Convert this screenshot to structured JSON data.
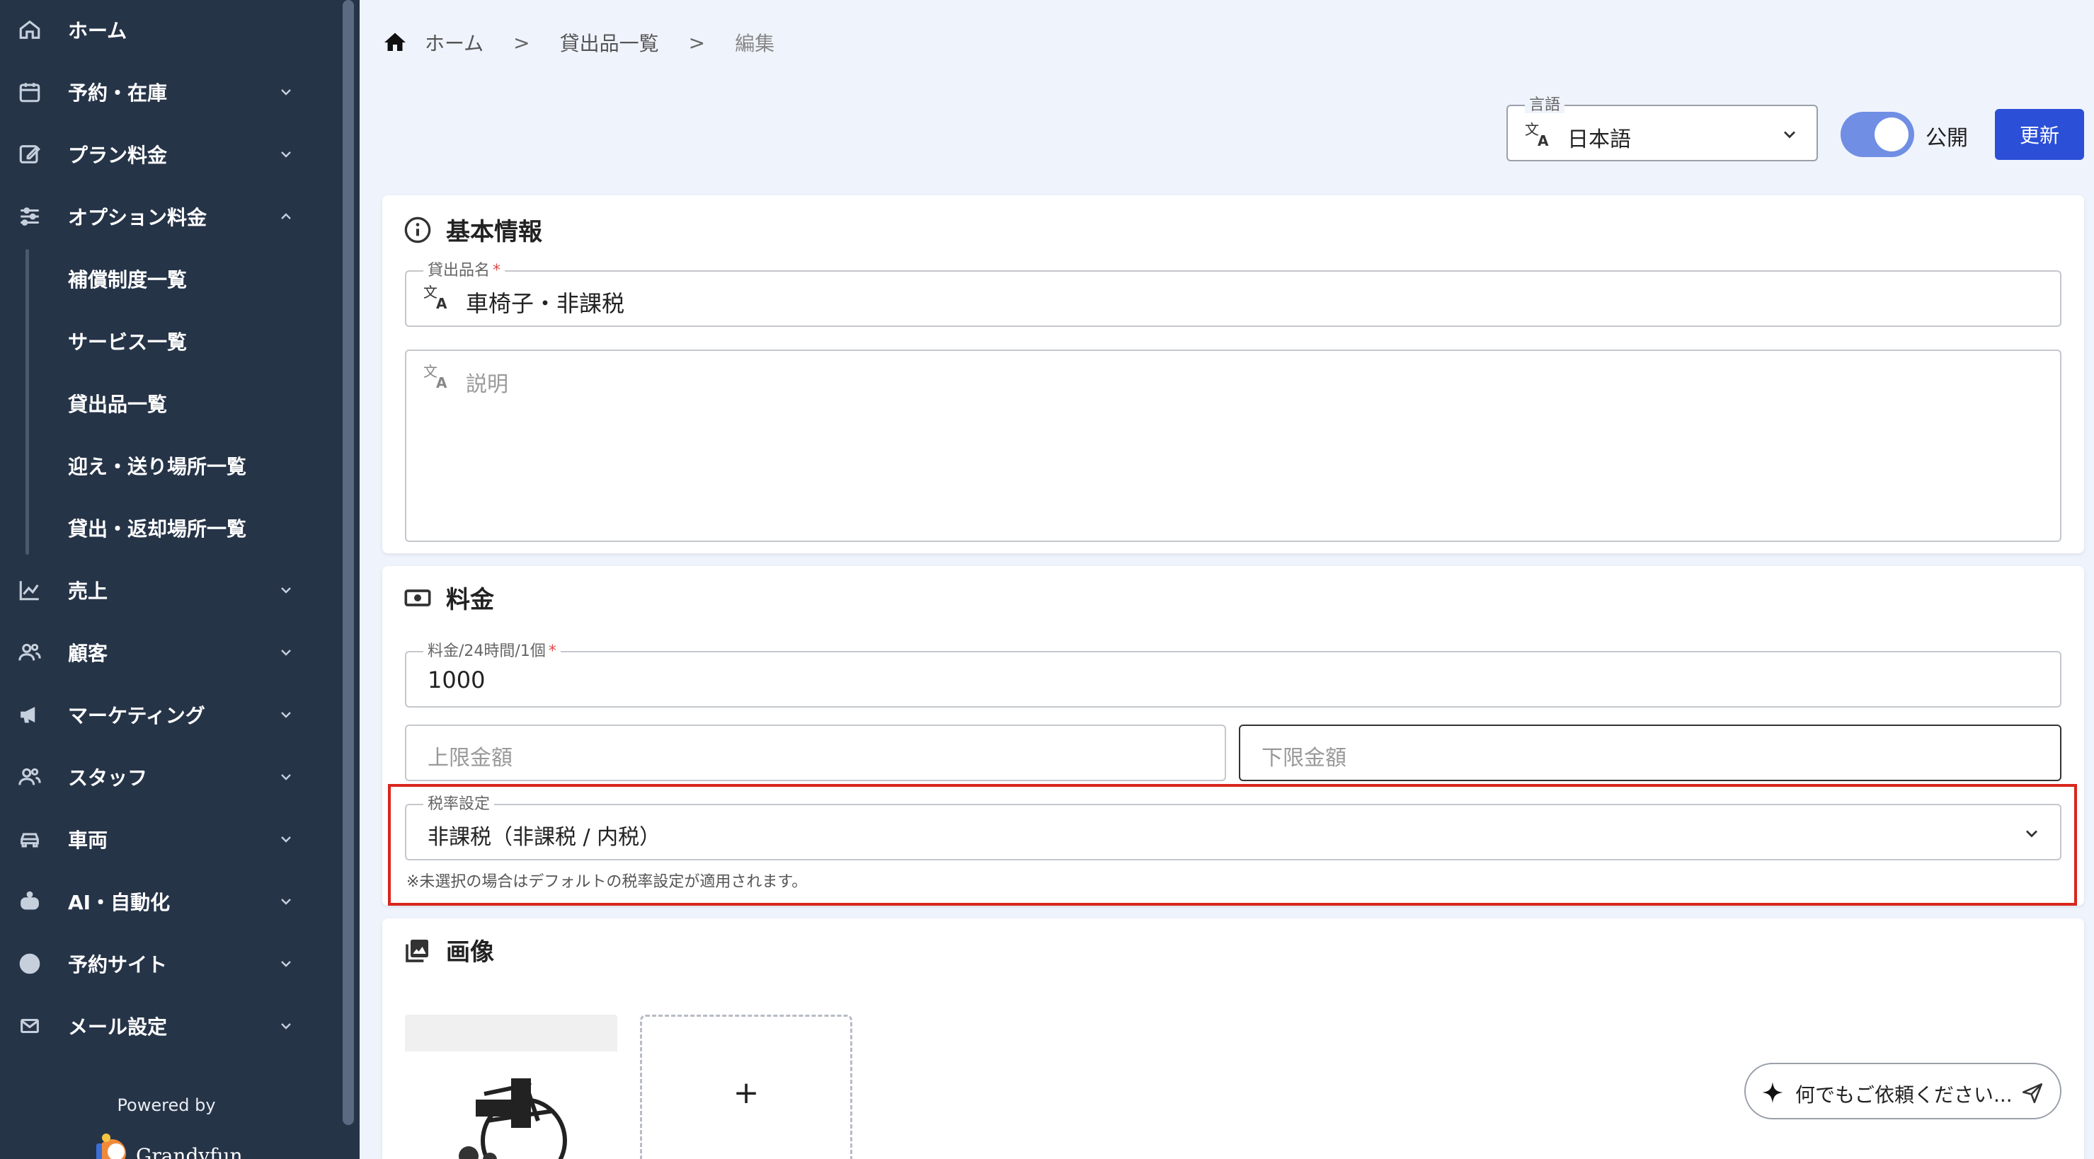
{
  "sidebar": {
    "items": [
      {
        "label": "ホーム",
        "icon": "home-icon",
        "chevron": ""
      },
      {
        "label": "予約・在庫",
        "icon": "calendar-icon",
        "chevron": "down"
      },
      {
        "label": "プラン料金",
        "icon": "edit-icon",
        "chevron": "down"
      },
      {
        "label": "オプション料金",
        "icon": "sliders-icon",
        "chevron": "up"
      },
      {
        "label": "補償制度一覧"
      },
      {
        "label": "サービス一覧"
      },
      {
        "label": "貸出品一覧"
      },
      {
        "label": "迎え・送り場所一覧"
      },
      {
        "label": "貸出・返却場所一覧"
      },
      {
        "label": "売上",
        "icon": "chart-icon",
        "chevron": "down"
      },
      {
        "label": "顧客",
        "icon": "users-icon",
        "chevron": "down"
      },
      {
        "label": "マーケティング",
        "icon": "megaphone-icon",
        "chevron": "down"
      },
      {
        "label": "スタッフ",
        "icon": "staff-icon",
        "chevron": "down"
      },
      {
        "label": "車両",
        "icon": "car-icon",
        "chevron": "down"
      },
      {
        "label": "AI・自動化",
        "icon": "robot-icon",
        "chevron": "down"
      },
      {
        "label": "予約サイト",
        "icon": "globe-icon",
        "chevron": "down"
      },
      {
        "label": "メール設定",
        "icon": "mail-icon",
        "chevron": "down"
      }
    ],
    "powered_by": "Powered by",
    "brand": "Grandyfun"
  },
  "breadcrumb": {
    "home": "ホーム",
    "list": "貸出品一覧",
    "current": "編集",
    "separator": ">"
  },
  "header": {
    "language_label": "言語",
    "language_value": "日本語",
    "publish_label": "公開",
    "publish_on": true,
    "update_button": "更新"
  },
  "basic_info": {
    "title": "基本情報",
    "name_label": "貸出品名",
    "required_mark": "*",
    "name_value": "車椅子・非課税",
    "description_placeholder": "説明"
  },
  "pricing": {
    "title": "料金",
    "price_label": "料金/24時間/1個",
    "required_mark": "*",
    "price_value": "1000",
    "max_placeholder": "上限金額",
    "min_placeholder": "下限金額",
    "tax_label": "税率設定",
    "tax_value": "非課税（非課税 / 内税）",
    "tax_helper": "※未選択の場合はデフォルトの税率設定が適用されます。"
  },
  "images": {
    "title": "画像",
    "add_label": "+"
  },
  "ai_assistant": {
    "placeholder": "何でもご依頼ください..."
  },
  "colors": {
    "sidebar_bg": "#263448",
    "page_bg": "#eff3fc",
    "primary": "#2b4fd6",
    "toggle": "#6f8ee4",
    "highlight": "#d8261d"
  }
}
